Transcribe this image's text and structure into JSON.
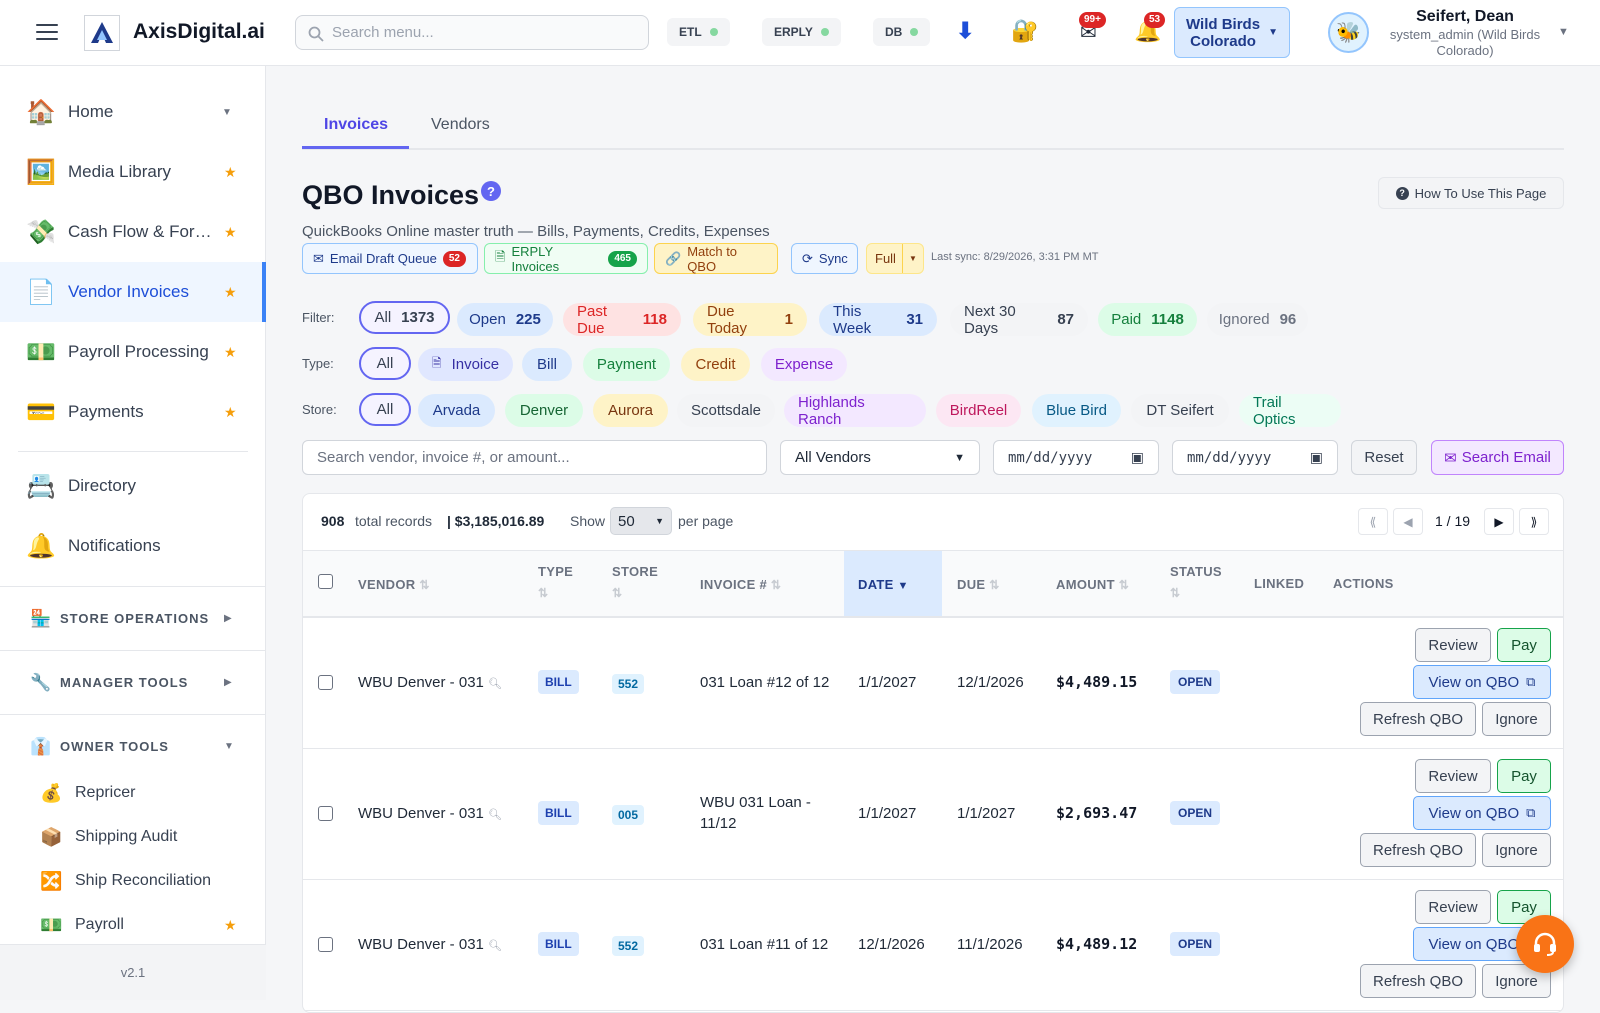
{
  "app": {
    "brand": "AxisDigital.ai",
    "search_placeholder": "Search menu..."
  },
  "status_pills": [
    {
      "label": "ETL"
    },
    {
      "label": "ERPLY"
    },
    {
      "label": "DB"
    }
  ],
  "top_icons": {
    "mail_badge": "99+",
    "bell_badge": "53"
  },
  "store_selector": {
    "line1": "Wild Birds",
    "line2": "Colorado"
  },
  "user": {
    "name": "Seifert, Dean",
    "role": "system_admin (Wild Birds Colorado)"
  },
  "sidebar": {
    "items": [
      {
        "label": "Home",
        "icon": "home-icon"
      },
      {
        "label": "Media Library",
        "icon": "picture-icon"
      },
      {
        "label": "Cash Flow & For…",
        "icon": "money-icon"
      },
      {
        "label": "Vendor Invoices",
        "icon": "document-icon"
      },
      {
        "label": "Payroll Processing",
        "icon": "dollar-bill-icon"
      },
      {
        "label": "Payments",
        "icon": "credit-card-icon"
      },
      {
        "label": "Directory",
        "icon": "rolodex-icon"
      },
      {
        "label": "Notifications",
        "icon": "bell-icon"
      }
    ],
    "sections": [
      {
        "label": "STORE OPERATIONS",
        "icon": "store-icon"
      },
      {
        "label": "MANAGER TOOLS",
        "icon": "wrench-icon"
      },
      {
        "label": "OWNER TOOLS",
        "icon": "briefcase-icon"
      }
    ],
    "owner_tools": [
      {
        "label": "Repricer",
        "icon": "money-bag-icon"
      },
      {
        "label": "Shipping Audit",
        "icon": "package-icon"
      },
      {
        "label": "Ship Reconciliation",
        "icon": "shuffle-icon"
      },
      {
        "label": "Payroll",
        "icon": "dollar-bill-icon"
      }
    ],
    "version": "v2.1"
  },
  "tabs": [
    {
      "label": "Invoices"
    },
    {
      "label": "Vendors"
    }
  ],
  "page": {
    "title": "QBO Invoices",
    "help": "?",
    "subtitle": "QuickBooks Online master truth — Bills, Payments, Credits, Expenses",
    "how_to": "How To Use This Page",
    "email_queue": {
      "label": "Email Draft Queue",
      "count": "52"
    },
    "erply_invoices": {
      "label": "ERPLY Invoices",
      "count": "465"
    },
    "match": "Match to QBO",
    "sync": "Sync",
    "sync_mode": "Full",
    "last_sync": "Last sync: 8/29/2026, 3:31 PM MT"
  },
  "filters": {
    "filter_label": "Filter:",
    "type_label": "Type:",
    "store_label": "Store:",
    "status": [
      {
        "label": "All",
        "count": "1373"
      },
      {
        "label": "Open",
        "count": "225"
      },
      {
        "label": "Past Due",
        "count": "118"
      },
      {
        "label": "Due Today",
        "count": "1"
      },
      {
        "label": "This Week",
        "count": "31"
      },
      {
        "label": "Next 30 Days",
        "count": "87"
      },
      {
        "label": "Paid",
        "count": "1148"
      },
      {
        "label": "Ignored",
        "count": "96"
      }
    ],
    "types": [
      "All",
      "Invoice",
      "Bill",
      "Payment",
      "Credit",
      "Expense"
    ],
    "stores": [
      "All",
      "Arvada",
      "Denver",
      "Aurora",
      "Scottsdale",
      "Highlands Ranch",
      "BirdReel",
      "Blue Bird",
      "DT Seifert",
      "Trail Optics"
    ],
    "search_placeholder": "Search vendor, invoice #, or amount...",
    "vendor_select": "All Vendors",
    "date_from": "mm/dd/yyyy",
    "date_to": "mm/dd/yyyy",
    "reset": "Reset",
    "search_email": "Search Email"
  },
  "table": {
    "total_records": "908",
    "total_records_label": "total records",
    "total_amount": "| $3,185,016.89",
    "show": "Show",
    "per_page_value": "50",
    "per_page": "per page",
    "page_indicator": "1 / 19",
    "headers": {
      "vendor": "VENDOR",
      "type": "TYPE",
      "store": "STORE",
      "invoice": "INVOICE #",
      "date": "DATE",
      "due": "DUE",
      "amount": "AMOUNT",
      "status": "STATUS",
      "linked": "LINKED",
      "actions": "ACTIONS"
    },
    "actions": {
      "review": "Review",
      "pay": "Pay",
      "view_qbo": "View on QBO",
      "refresh": "Refresh QBO",
      "ignore": "Ignore"
    },
    "rows": [
      {
        "vendor": "WBU Denver - 031",
        "type": "BILL",
        "store": "552",
        "invoice": "031 Loan #12 of 12",
        "date": "1/1/2027",
        "due": "12/1/2026",
        "amount": "$4,489.15",
        "status": "OPEN"
      },
      {
        "vendor": "WBU Denver - 031",
        "type": "BILL",
        "store": "005",
        "invoice": "WBU 031 Loan - 11/12",
        "date": "1/1/2027",
        "due": "1/1/2027",
        "amount": "$2,693.47",
        "status": "OPEN"
      },
      {
        "vendor": "WBU Denver - 031",
        "type": "BILL",
        "store": "552",
        "invoice": "031 Loan #11 of 12",
        "date": "12/1/2026",
        "due": "11/1/2026",
        "amount": "$4,489.12",
        "status": "OPEN"
      }
    ]
  },
  "colors": {
    "accent": "#6366f1",
    "active_nav": "#1d4ed8",
    "fab": "#f97316"
  }
}
